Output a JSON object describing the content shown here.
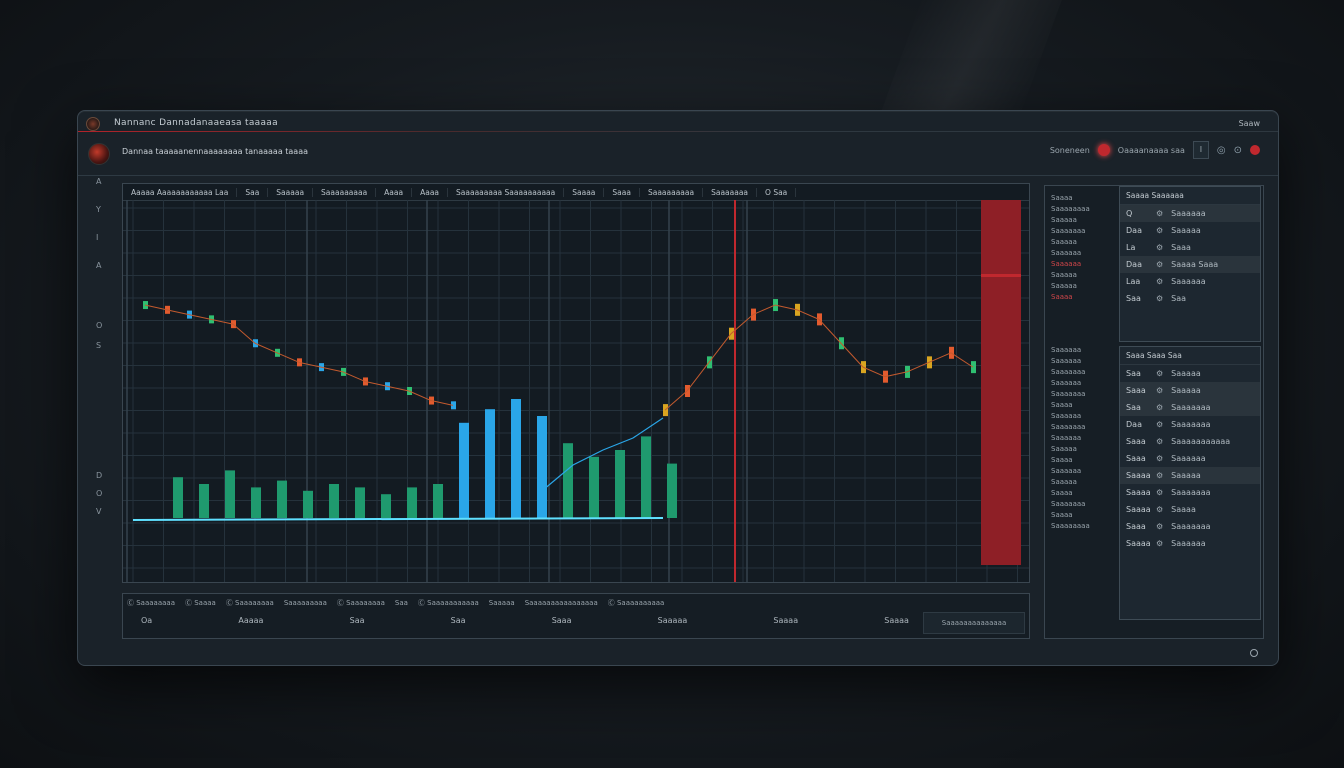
{
  "window": {
    "title": "Nannanc Dannadanaaeasa taaaaa",
    "corner_label": "Saaw",
    "subtitle": "Dannaa taaaaanennaaaaaaaa tanaaaaa taaaa",
    "controls": {
      "status_text": "Soneneen",
      "search_text": "Oaaaanaaaa saa",
      "square_label": "Ι"
    }
  },
  "left_strip": [
    "A",
    "Y",
    "I",
    "A",
    "O",
    "S",
    "D",
    "O",
    "V"
  ],
  "chart": {
    "header_tabs": [
      "Aaaaa Aaaaaaaaaaaa Laa",
      "Saa",
      "Saaaaa",
      "Saaaaaaaaa",
      "Aaaa",
      "Aaaa",
      "Saaaaaaaaa Saaaaaaaaaa",
      "Saaaa",
      "Saaa",
      "Saaaaaaaaa",
      "Saaaaaaa",
      "O Saa"
    ]
  },
  "chart_data": {
    "type": "line",
    "series": [
      {
        "values": [
          58,
          57,
          56,
          55,
          54,
          50,
          48,
          46,
          45,
          44,
          42,
          41,
          40,
          38,
          37
        ]
      },
      {
        "values": [
          36,
          40,
          46,
          52,
          56,
          58,
          57,
          55,
          50,
          45,
          43,
          44,
          46,
          48,
          45
        ]
      }
    ],
    "volume": [
      12,
      10,
      14,
      9,
      11,
      8,
      10,
      9,
      7,
      9,
      10,
      28,
      32,
      35,
      30,
      22,
      18,
      20,
      24,
      16
    ],
    "colors": {
      "up": "#2fbf71",
      "down": "#e35b2e",
      "alt": "#2aa6e8",
      "warn": "#d9a520",
      "marker": "#c0282e",
      "grid": "#25323c"
    }
  },
  "bottom": {
    "row1": [
      "Ⓒ Saaaaaaaa",
      "Ⓒ Saaaa",
      "Ⓒ Saaaaaaaa",
      "Saaaaaaaaa",
      "Ⓒ Saaaaaaaa",
      "Saa",
      "Ⓒ Saaaaaaaaaaa",
      "Saaaaa",
      "Saaaaaaaaaaaaaaaa",
      "Ⓒ Saaaaaaaaaa"
    ],
    "row2": [
      "Oa",
      "Aaaaa",
      "Saa",
      "Saa",
      "Saaa",
      "Saaaaa",
      "Saaaa",
      "Saaaa"
    ],
    "right_box": "Saaaaaaaaaaaaaa"
  },
  "right_panel": {
    "header": "Saaaaa   Saaaaaa",
    "left_labels_top": [
      "Saaaa",
      "Saaaaaaaa",
      "Saaaaa",
      "Saaaaaaa",
      "Saaaaa",
      "Saaaaaa",
      "Saaaaaa",
      "Saaaaa",
      "Saaaaa",
      "Saaaa"
    ],
    "left_labels_bottom": [
      "Saaaaaa",
      "Saaaaaa",
      "Saaaaaaa",
      "Saaaaaa",
      "Saaaaaaa",
      "Saaaa",
      "Saaaaaa",
      "Saaaaaaa",
      "Saaaaaa",
      "Saaaaa",
      "Saaaa",
      "Saaaaaa",
      "Saaaaa",
      "Saaaa",
      "Saaaaaaa",
      "Saaaa",
      "Saaaaaaaa"
    ],
    "box1": {
      "head": "Saaaa  Saaaaaa",
      "items": [
        {
          "k": "Q",
          "v": "Saaaaaa"
        },
        {
          "k": "Daa",
          "v": "Saaaaa"
        },
        {
          "k": "La",
          "v": "Saaa"
        },
        {
          "k": "Daa",
          "v": "Saaaa Saaa"
        },
        {
          "k": "Laa",
          "v": "Saaaaaa"
        },
        {
          "k": "Saa",
          "v": "Saa"
        }
      ]
    },
    "box2": {
      "head": "Saaa Saaa  Saa",
      "items": [
        {
          "k": "Saa",
          "v": "Saaaaa"
        },
        {
          "k": "Saaa",
          "v": "Saaaaa"
        },
        {
          "k": "Saa",
          "v": "Saaaaaaa"
        },
        {
          "k": "Daa",
          "v": "Saaaaaaa"
        },
        {
          "k": "Saaa",
          "v": "Saaaaaaaaaaa"
        },
        {
          "k": "Saaa",
          "v": "Saaaaaa"
        },
        {
          "k": "Saaaa",
          "v": "Saaaaa"
        },
        {
          "k": "Saaaa",
          "v": "Saaaaaaa"
        },
        {
          "k": "Saaaa",
          "v": "Saaaa"
        },
        {
          "k": "Saaa",
          "v": "Saaaaaaa"
        },
        {
          "k": "Saaaa",
          "v": "Saaaaaa"
        }
      ]
    }
  }
}
